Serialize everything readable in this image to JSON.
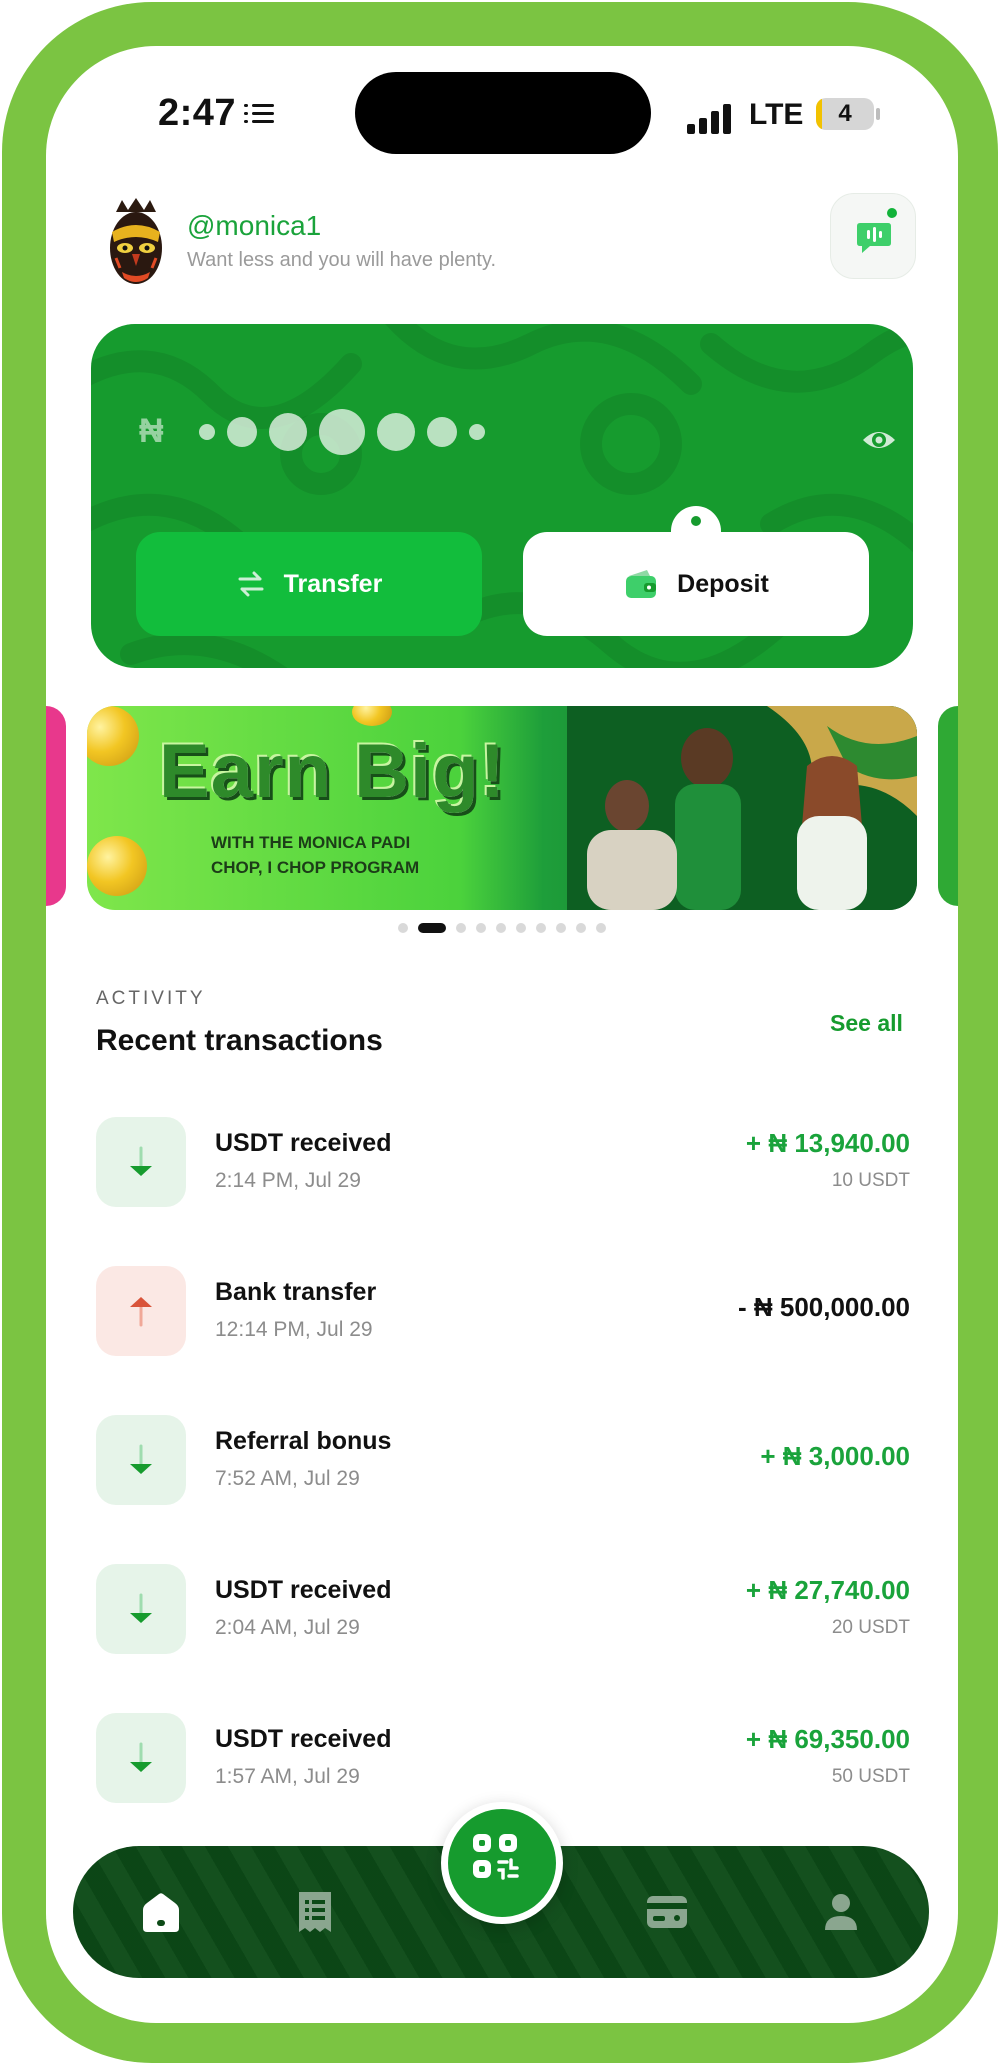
{
  "status_bar": {
    "time": "2:47",
    "network": "LTE",
    "battery": "4"
  },
  "profile": {
    "username": "@monica1",
    "tagline": "Want less and you will have plenty."
  },
  "balance": {
    "currency_symbol": "₦",
    "hidden": true
  },
  "actions": {
    "transfer_label": "Transfer",
    "deposit_label": "Deposit"
  },
  "promo": {
    "title": "Earn Big!",
    "subtitle_line1": "WITH THE MONICA PADI",
    "subtitle_line2": "CHOP, I CHOP PROGRAM",
    "slide_count": 10,
    "active_slide": 2
  },
  "activity": {
    "section_label": "ACTIVITY",
    "title": "Recent transactions",
    "see_all": "See all",
    "transactions": [
      {
        "name": "USDT received",
        "time": "2:14 PM, Jul 29",
        "amount": "+ ₦ 13,940.00",
        "sub": "10 USDT",
        "direction": "in"
      },
      {
        "name": "Bank transfer",
        "time": "12:14 PM, Jul 29",
        "amount": "- ₦ 500,000.00",
        "sub": "",
        "direction": "out"
      },
      {
        "name": "Referral bonus",
        "time": "7:52 AM, Jul 29",
        "amount": "+ ₦ 3,000.00",
        "sub": "",
        "direction": "in"
      },
      {
        "name": "USDT received",
        "time": "2:04 AM, Jul 29",
        "amount": "+ ₦ 27,740.00",
        "sub": "20 USDT",
        "direction": "in"
      },
      {
        "name": "USDT received",
        "time": "1:57 AM, Jul 29",
        "amount": "+ ₦ 69,350.00",
        "sub": "50 USDT",
        "direction": "in"
      }
    ]
  },
  "nav": {
    "items": [
      "home-icon",
      "receipt-icon",
      "qr-scan-icon",
      "card-icon",
      "profile-icon"
    ],
    "active": "home-icon"
  },
  "colors": {
    "frame": "#7bc442",
    "brand_green": "#169b2e",
    "bright_green": "#12bd3c",
    "nav_dark": "#0c4a17",
    "credit_text": "#1aa33b",
    "debit_icon": "#d9543a"
  }
}
